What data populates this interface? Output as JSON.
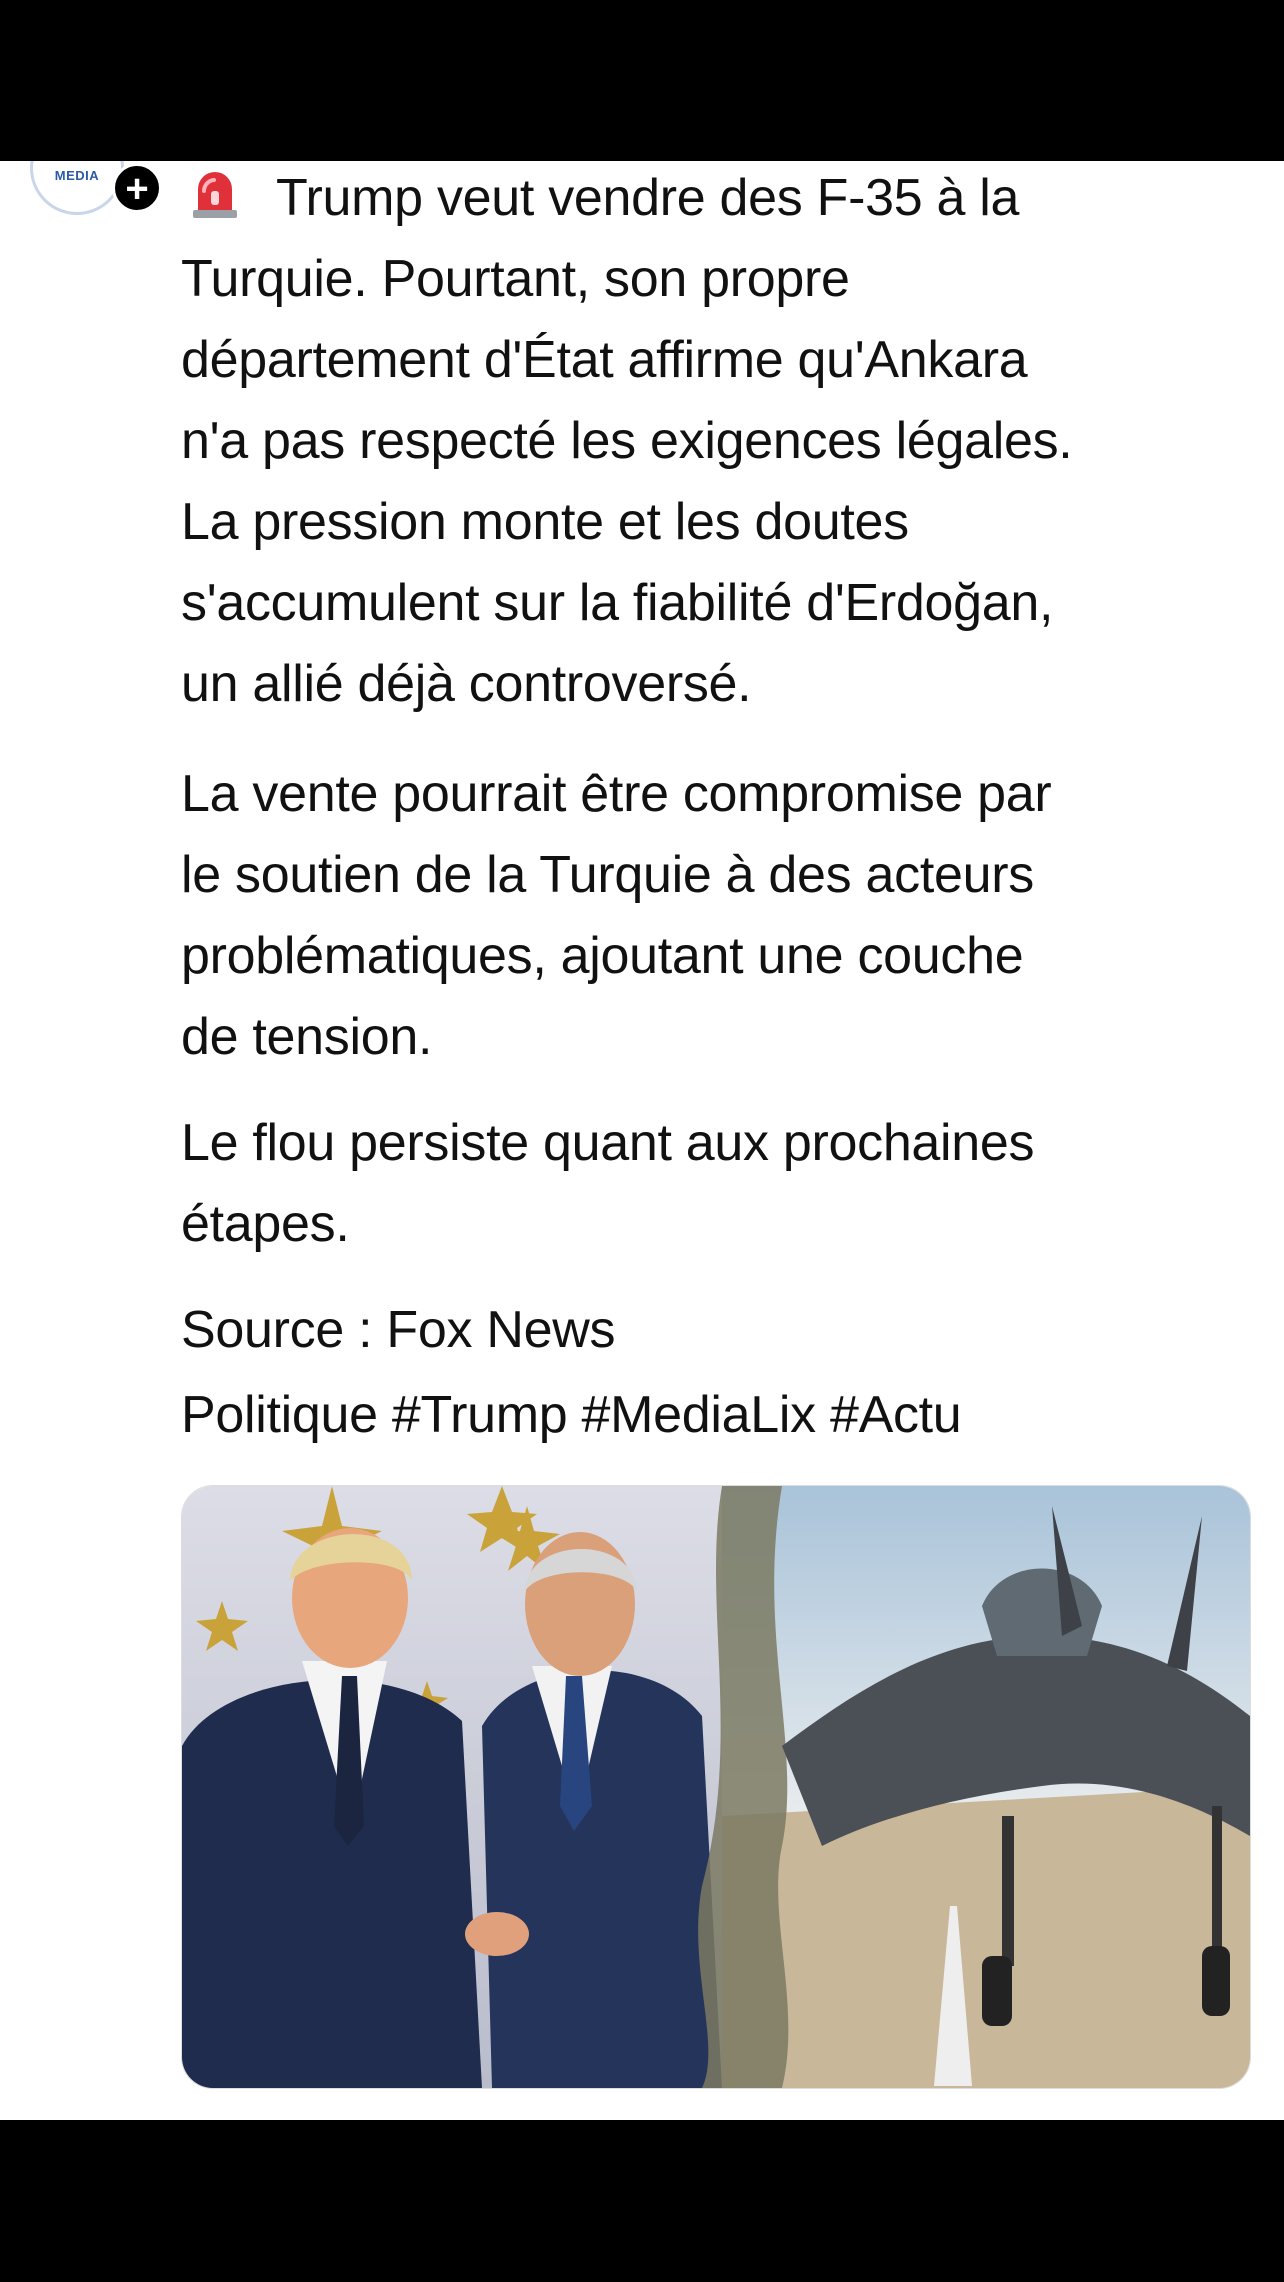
{
  "post": {
    "avatar_text": "MEDIA",
    "follow_badge": "+",
    "paragraph1_first_line": "Trump veut vendre des F-35 à la",
    "paragraph1_rest": "Turquie. Pourtant, son propre\ndépartement d'État affirme qu'Ankara\nn'a pas respecté les exigences légales.\nLa pression monte et les doutes\ns'accumulent sur la fiabilité d'Erdoğan,\nun allié déjà controversé.",
    "paragraph2": "La vente pourrait être compromise par\nle soutien de la Turquie à des acteurs\nproblématiques, ajoutant une couche\nde tension.",
    "paragraph3": "Le flou persiste quant aux prochaines\nétapes.",
    "source": "Source : Fox News",
    "tags": "Politique #Trump #MediaLix #Actu",
    "leading_icon": "siren-icon",
    "image_icon": "photo-icon"
  },
  "colors": {
    "text": "#111111",
    "background": "#ffffff",
    "bars": "#000000",
    "siren": "#e0313a"
  }
}
